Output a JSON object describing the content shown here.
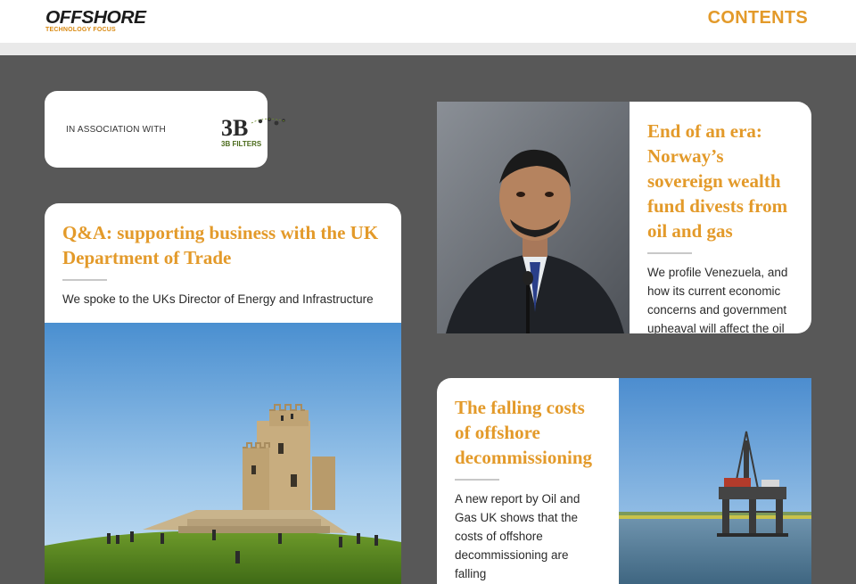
{
  "header": {
    "logo_main": "OFFSHORE",
    "logo_sub": "TECHNOLOGY FOCUS",
    "contents_label": "CONTENTS"
  },
  "association": {
    "label": "IN ASSOCIATION WITH",
    "partner_logo_text": "3B FILTERS"
  },
  "articles": [
    {
      "title": "Q&A: supporting business with the UK Department of Trade",
      "description": "We spoke to the UKs Director of Energy and Infrastructure"
    },
    {
      "title": "End of an era: Norway’s sovereign wealth fund divests from oil and gas",
      "description": "We profile Venezuela, and how its current economic concerns and government upheaval will affect the oil"
    },
    {
      "title": "The falling costs of offshore decommissioning",
      "description": "A new report by Oil and Gas UK shows that the costs of offshore decommissioning are falling"
    }
  ],
  "colors": {
    "accent": "#e39a2a",
    "background": "#585858",
    "card": "#ffffff"
  }
}
